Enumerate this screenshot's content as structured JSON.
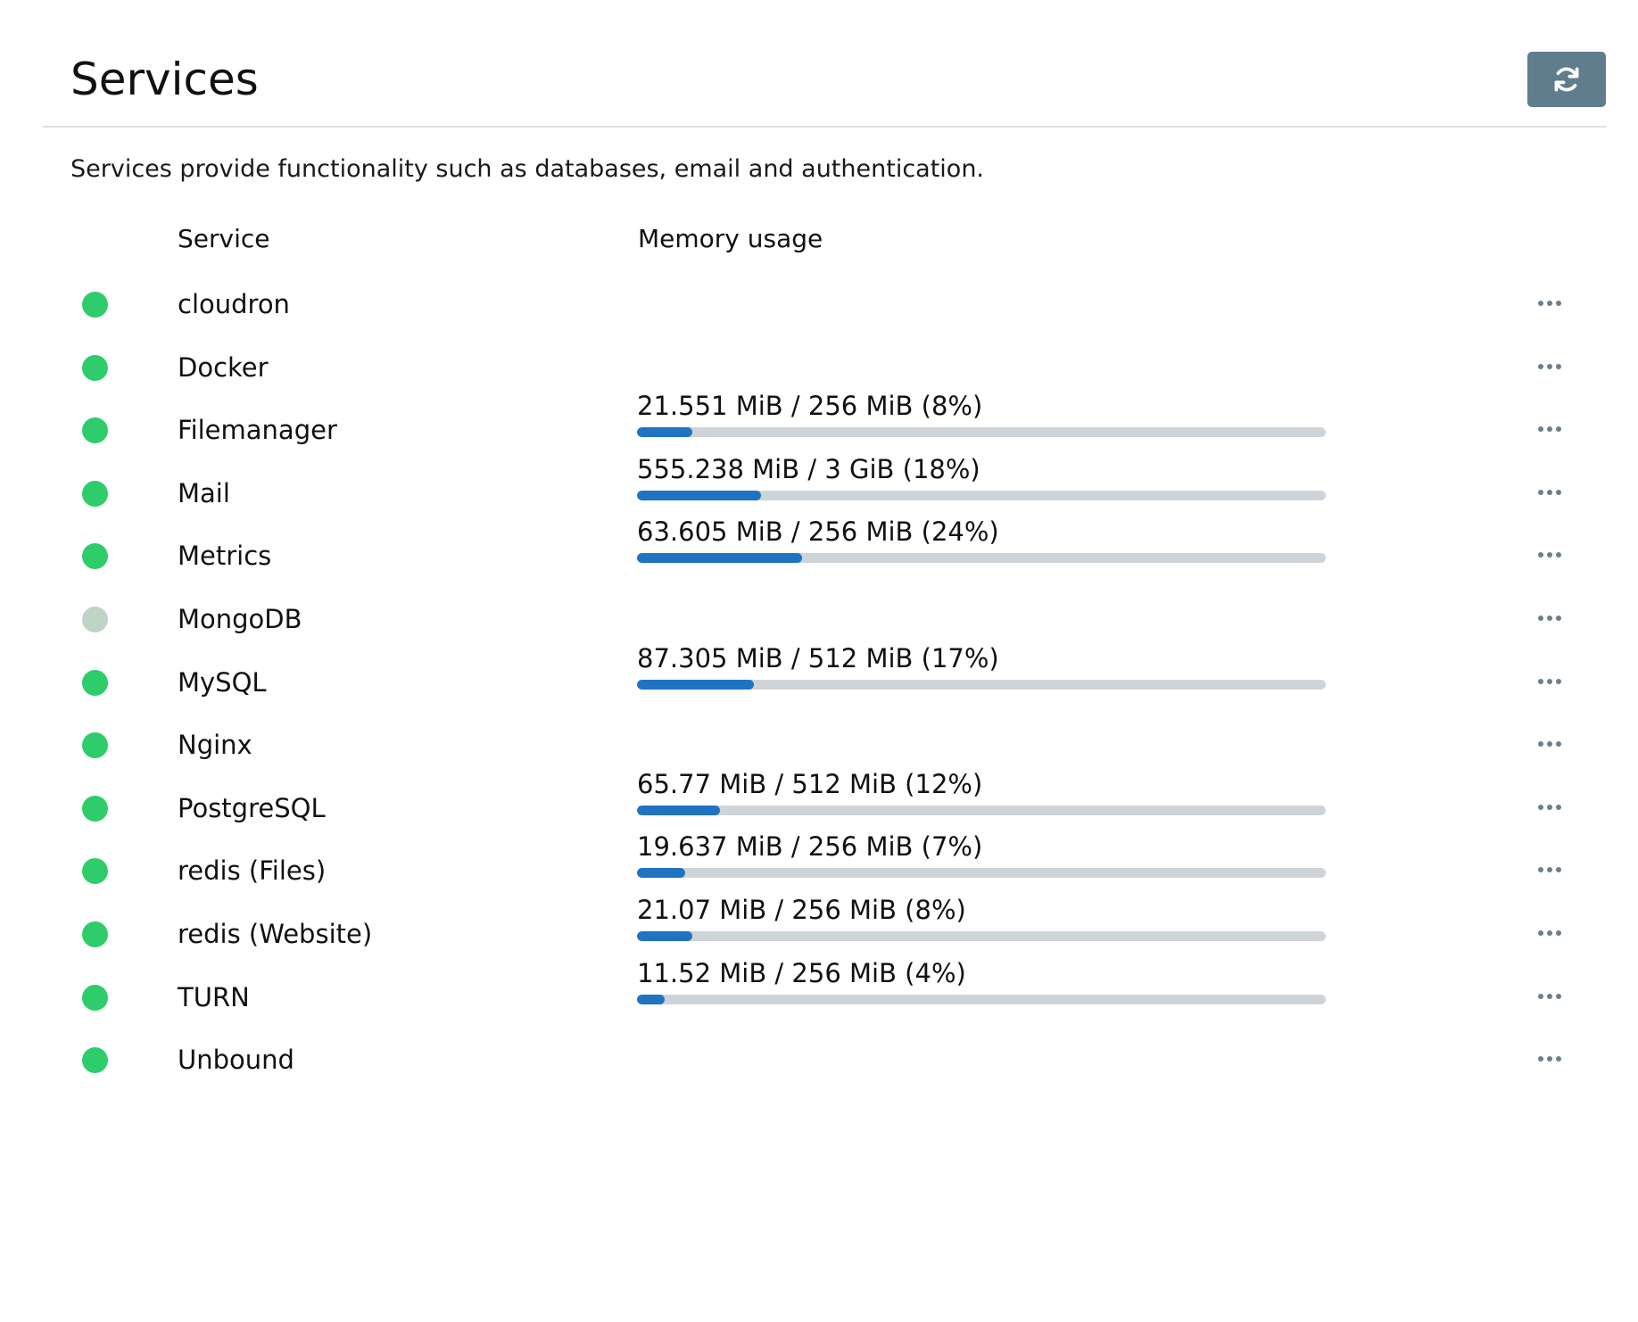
{
  "header": {
    "title": "Services",
    "refresh_icon": "refresh-icon"
  },
  "description": "Services provide functionality such as databases, email and authentication.",
  "table": {
    "columns": {
      "service": "Service",
      "memory": "Memory usage"
    },
    "more_icon": "ellipsis-icon",
    "colors": {
      "status_active": "#2ecc6b",
      "status_inactive": "#bfd3c7",
      "bar_fill": "#1f73c1",
      "bar_track": "#cfd4d9"
    },
    "rows": [
      {
        "name": "cloudron",
        "status": "active",
        "memory_text": "",
        "memory_fraction": null
      },
      {
        "name": "Docker",
        "status": "active",
        "memory_text": "",
        "memory_fraction": null
      },
      {
        "name": "Filemanager",
        "status": "active",
        "memory_text": "21.551 MiB / 256 MiB (8%)",
        "memory_fraction": 0.08
      },
      {
        "name": "Mail",
        "status": "active",
        "memory_text": "555.238 MiB / 3 GiB (18%)",
        "memory_fraction": 0.18
      },
      {
        "name": "Metrics",
        "status": "active",
        "memory_text": "63.605 MiB / 256 MiB (24%)",
        "memory_fraction": 0.24
      },
      {
        "name": "MongoDB",
        "status": "inactive",
        "memory_text": "",
        "memory_fraction": null
      },
      {
        "name": "MySQL",
        "status": "active",
        "memory_text": "87.305 MiB / 512 MiB (17%)",
        "memory_fraction": 0.17
      },
      {
        "name": "Nginx",
        "status": "active",
        "memory_text": "",
        "memory_fraction": null
      },
      {
        "name": "PostgreSQL",
        "status": "active",
        "memory_text": "65.77 MiB / 512 MiB (12%)",
        "memory_fraction": 0.12
      },
      {
        "name": "redis (Files)",
        "status": "active",
        "memory_text": "19.637 MiB / 256 MiB (7%)",
        "memory_fraction": 0.07
      },
      {
        "name": "redis (Website)",
        "status": "active",
        "memory_text": "21.07 MiB / 256 MiB (8%)",
        "memory_fraction": 0.08
      },
      {
        "name": "TURN",
        "status": "active",
        "memory_text": "11.52 MiB / 256 MiB (4%)",
        "memory_fraction": 0.04
      },
      {
        "name": "Unbound",
        "status": "active",
        "memory_text": "",
        "memory_fraction": null
      }
    ]
  }
}
